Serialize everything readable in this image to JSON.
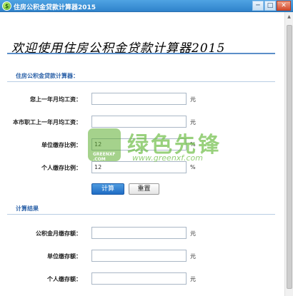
{
  "window": {
    "title": "住房公积金贷款计算器2015",
    "min": "─",
    "max": "□",
    "close": "✕"
  },
  "banner": "欢迎使用住房公积金贷款计算器2015",
  "form": {
    "section_title": "住房公积金贷款计算器：",
    "rows": [
      {
        "label": "您上一年月均工资：",
        "value": "",
        "unit": "元"
      },
      {
        "label": "本市职工上一年月均工资：",
        "value": "",
        "unit": "元"
      },
      {
        "label": "单位缴存比例：",
        "value": "12",
        "unit": "%"
      },
      {
        "label": "个人缴存比例：",
        "value": "12",
        "unit": "%"
      }
    ]
  },
  "buttons": {
    "calc": "计算",
    "reset": "重置"
  },
  "result": {
    "section_title": "计算结果",
    "rows": [
      {
        "label": "公积金月缴存额：",
        "value": "",
        "unit": "元"
      },
      {
        "label": "单位缴存额：",
        "value": "",
        "unit": "元"
      },
      {
        "label": "个人缴存额：",
        "value": "",
        "unit": "元"
      }
    ]
  },
  "watermark": {
    "logo_text_1": "GREENXF",
    "logo_text_2": ".COM",
    "main": "绿色先锋",
    "url": "www.greenxf.com"
  },
  "colors": {
    "titlebar": "#2f83cb",
    "section_title": "#2b61a8",
    "calc_button": "#1f6cc4"
  }
}
